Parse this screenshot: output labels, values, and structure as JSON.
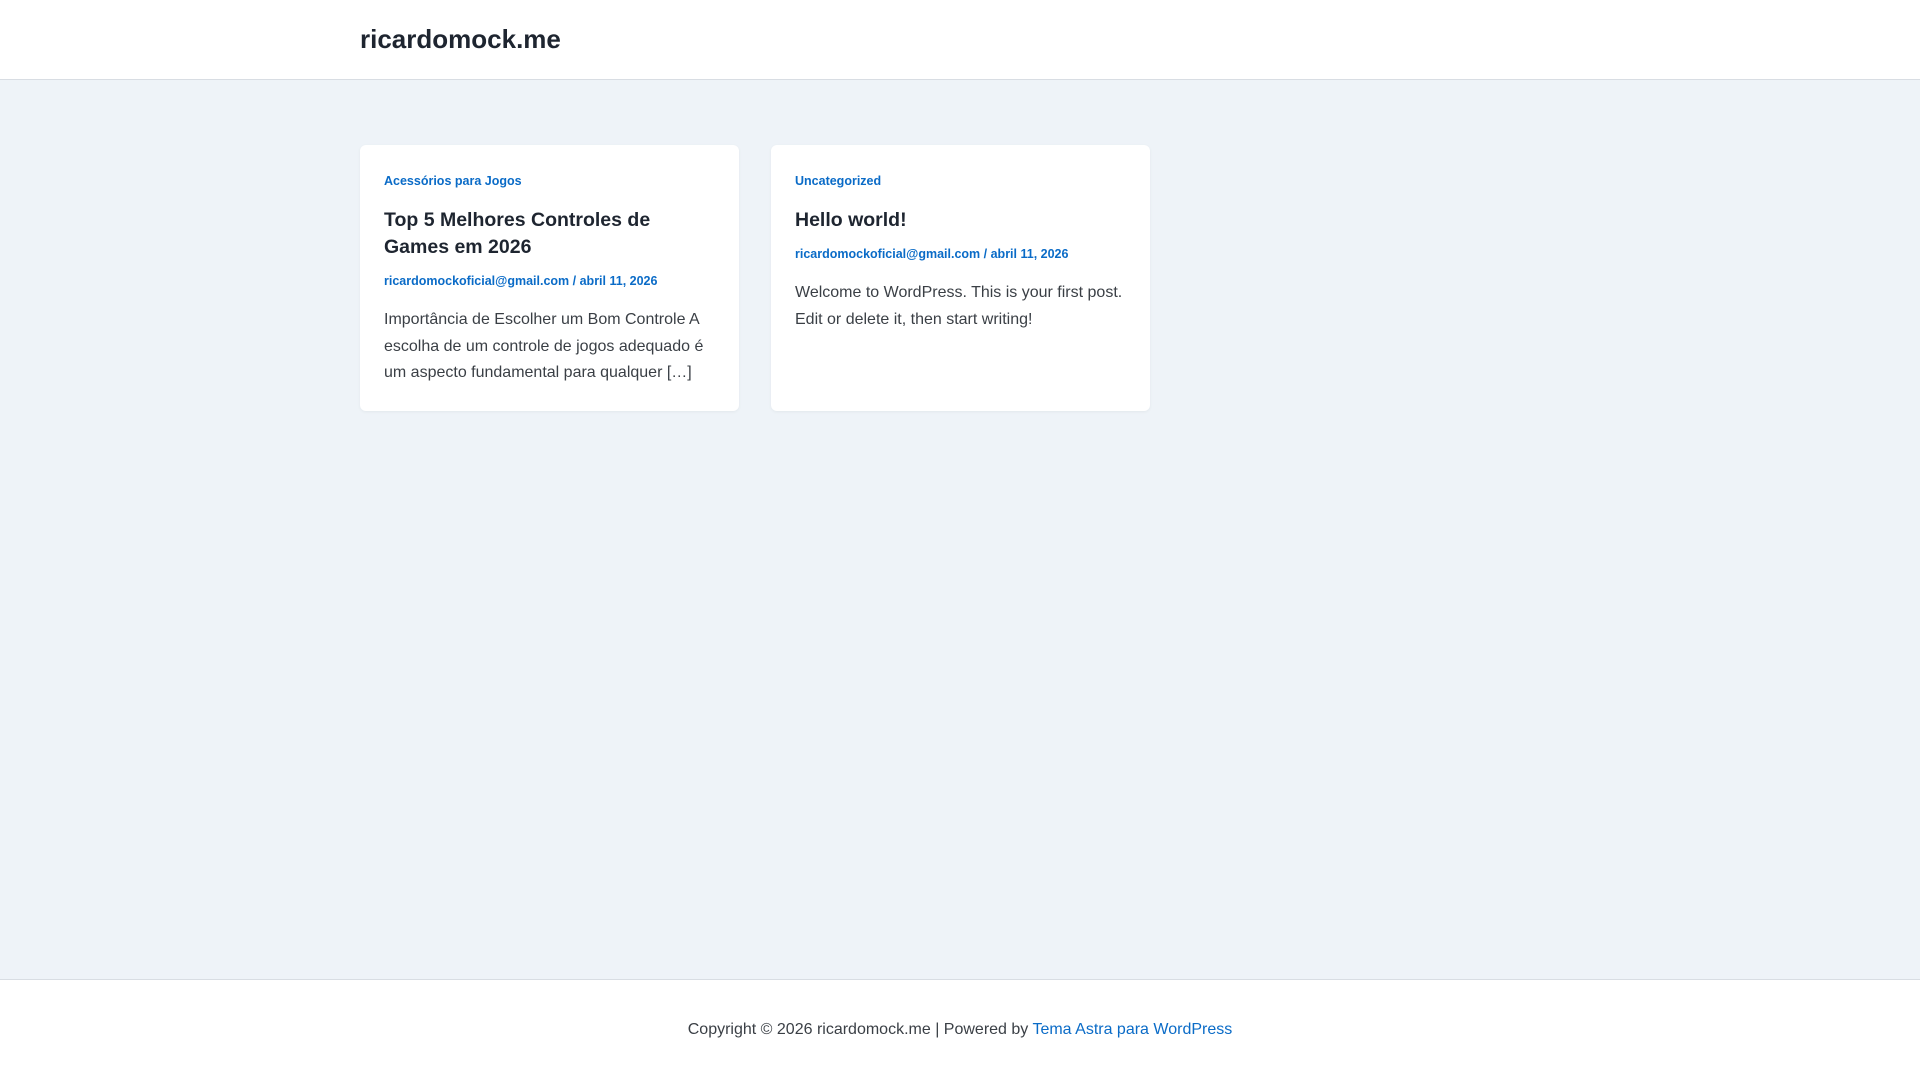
{
  "header": {
    "site_title": "ricardomock.me"
  },
  "posts": [
    {
      "category": "Acessórios para Jogos",
      "title": "Top 5 Melhores Controles de Games em 2026",
      "author": "ricardomockoficial@gmail.com",
      "separator": "/",
      "date": "abril 11, 2026",
      "excerpt": "Importância de Escolher um Bom Controle A escolha de um controle de jogos adequado é um aspecto fundamental para qualquer […]"
    },
    {
      "category": "Uncategorized",
      "title": "Hello world!",
      "author": "ricardomockoficial@gmail.com",
      "separator": "/",
      "date": "abril 11, 2026",
      "excerpt": "Welcome to WordPress. This is your first post. Edit or delete it, then start writing!"
    }
  ],
  "footer": {
    "copyright": "Copyright © 2026 ricardomock.me | Powered by ",
    "theme_link": "Tema Astra para WordPress"
  },
  "colors": {
    "accent": "#0a6bc7",
    "background": "#eef3f8",
    "heading": "#1e2530"
  }
}
